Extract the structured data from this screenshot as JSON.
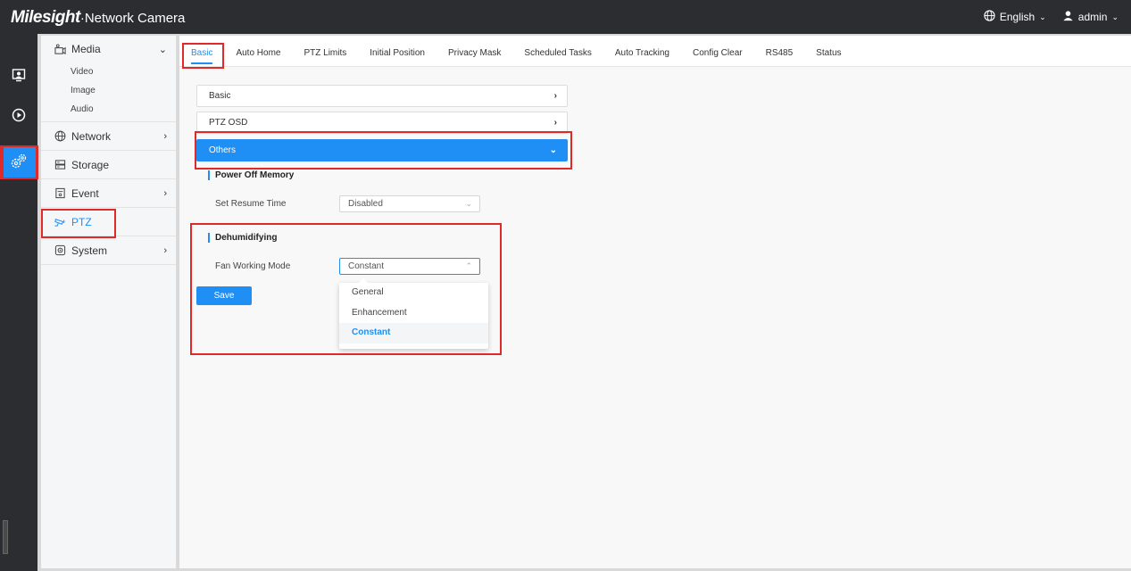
{
  "header": {
    "brand": "Milesight",
    "subtitle": "·Network Camera",
    "language": "English",
    "user": "admin"
  },
  "iconbar": {
    "items": [
      {
        "icon": "live-view-icon"
      },
      {
        "icon": "playback-icon"
      },
      {
        "icon": "settings-icon",
        "active": true
      }
    ]
  },
  "sidebar": {
    "media": "Media",
    "media_sub": [
      "Video",
      "Image",
      "Audio"
    ],
    "network": "Network",
    "storage": "Storage",
    "event": "Event",
    "ptz": "PTZ",
    "system": "System"
  },
  "tabs": [
    "Basic",
    "Auto Home",
    "PTZ Limits",
    "Initial Position",
    "Privacy Mask",
    "Scheduled Tasks",
    "Auto Tracking",
    "Config Clear",
    "RS485",
    "Status"
  ],
  "accordion": {
    "basic": "Basic",
    "ptz_osd": "PTZ OSD",
    "others": "Others"
  },
  "power_off_memory": {
    "title": "Power Off Memory",
    "label": "Set Resume Time",
    "value": "Disabled"
  },
  "dehumidifying": {
    "title": "Dehumidifying",
    "label": "Fan Working Mode",
    "value": "Constant",
    "options": [
      "General",
      "Enhancement",
      "Constant"
    ],
    "selected": "Constant"
  },
  "save_label": "Save",
  "colors": {
    "accent": "#1f8ff5",
    "highlight_box": "#e02a2a",
    "topbar": "#2b2d31"
  }
}
